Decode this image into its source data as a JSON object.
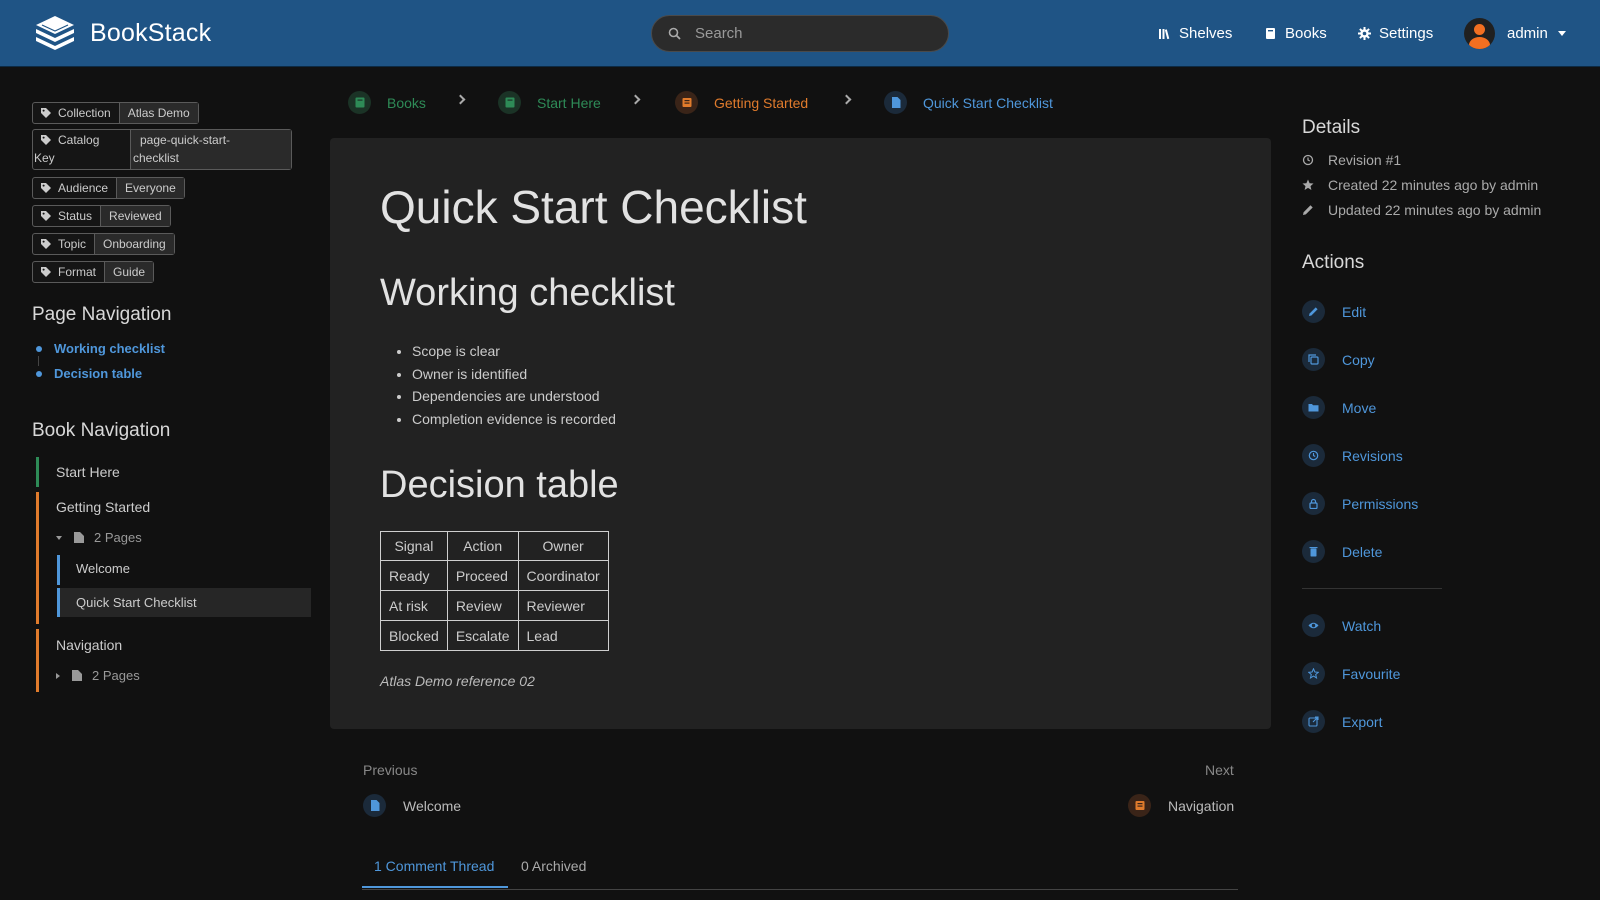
{
  "header": {
    "app_name": "BookStack",
    "search_placeholder": "Search",
    "nav": {
      "shelves": "Shelves",
      "books": "Books",
      "settings": "Settings"
    },
    "user": "admin"
  },
  "tags": [
    {
      "name": "Collection",
      "value": "Atlas Demo"
    },
    {
      "name_1": "Catalog",
      "name_2": "Key",
      "value_1": "page-quick-start-",
      "value_2": "checklist"
    },
    {
      "name": "Audience",
      "value": "Everyone"
    },
    {
      "name": "Status",
      "value": "Reviewed"
    },
    {
      "name": "Topic",
      "value": "Onboarding"
    },
    {
      "name": "Format",
      "value": "Guide"
    }
  ],
  "page_navigation": {
    "title": "Page Navigation",
    "items": [
      "Working checklist",
      "Decision table"
    ]
  },
  "book_navigation": {
    "title": "Book Navigation",
    "chapters": [
      {
        "label": "Start Here"
      },
      {
        "label": "Getting Started",
        "pages_label": "2 Pages",
        "pages": [
          "Welcome",
          "Quick Start Checklist"
        ]
      },
      {
        "label": "Navigation",
        "pages_label": "2 Pages"
      }
    ]
  },
  "breadcrumb": [
    "Books",
    "Start Here",
    "Getting Started",
    "Quick Start Checklist"
  ],
  "page": {
    "title": "Quick Start Checklist",
    "section1_heading": "Working checklist",
    "checklist": [
      "Scope is clear",
      "Owner is identified",
      "Dependencies are understood",
      "Completion evidence is recorded"
    ],
    "section2_heading": "Decision table",
    "table": {
      "headers": [
        "Signal",
        "Action",
        "Owner"
      ],
      "rows": [
        [
          "Ready",
          "Proceed",
          "Coordinator"
        ],
        [
          "At risk",
          "Review",
          "Reviewer"
        ],
        [
          "Blocked",
          "Escalate",
          "Lead"
        ]
      ]
    },
    "caption": "Atlas Demo reference 02"
  },
  "pager": {
    "previous_label": "Previous",
    "previous_page": "Welcome",
    "next_label": "Next",
    "next_page": "Navigation"
  },
  "comments": {
    "active_tab": "1 Comment Thread",
    "archived_tab": "0 Archived"
  },
  "details": {
    "title": "Details",
    "revision": "Revision #1",
    "created": "Created 22 minutes ago by admin",
    "updated": "Updated 22 minutes ago by admin"
  },
  "actions": {
    "title": "Actions",
    "edit": "Edit",
    "copy": "Copy",
    "move": "Move",
    "revisions": "Revisions",
    "permissions": "Permissions",
    "delete": "Delete",
    "watch": "Watch",
    "favourite": "Favourite",
    "export": "Export"
  },
  "colors": {
    "header": "#1f5485",
    "link": "#4f97db",
    "book": "#2e8b57",
    "chapter": "#e07b2c",
    "page": "#4f97db"
  }
}
